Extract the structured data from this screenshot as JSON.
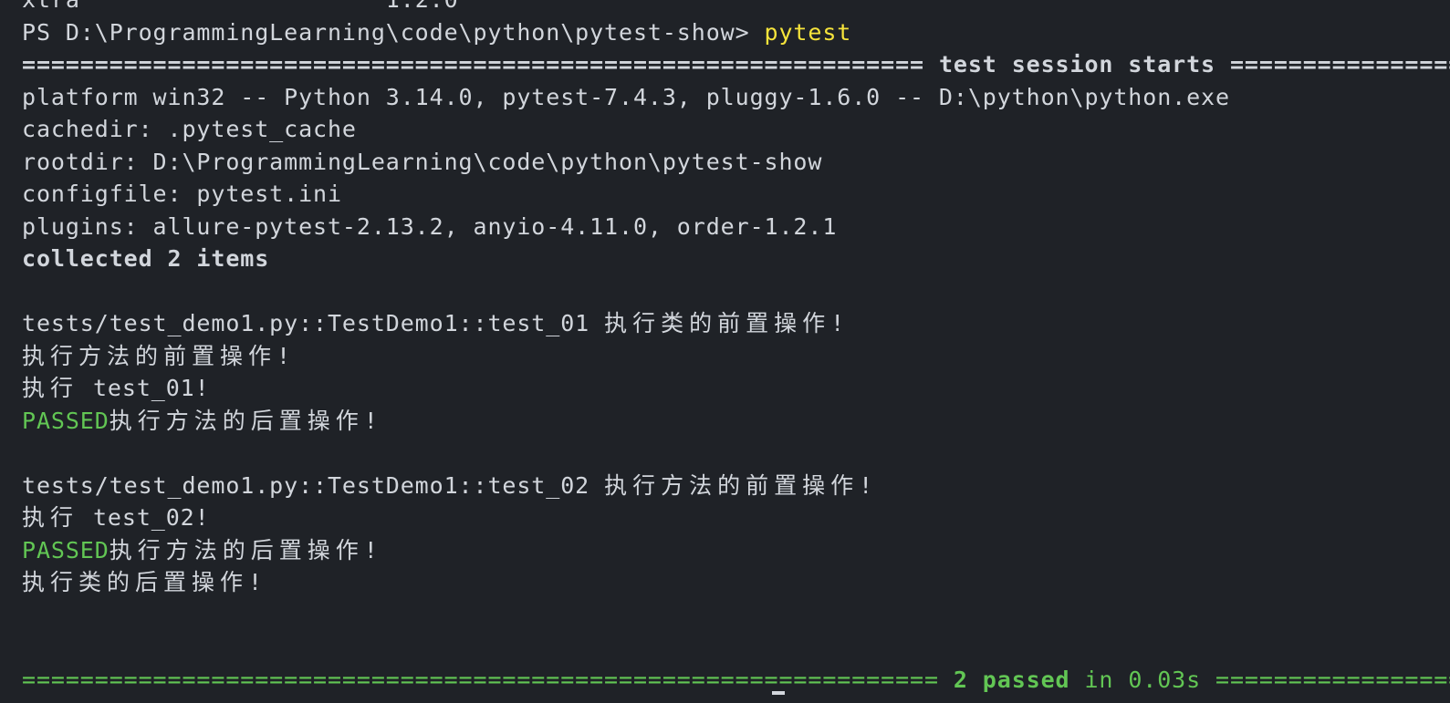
{
  "terminal": {
    "partial_top_left": "xtra",
    "partial_top_right": "1.2.0",
    "prompt": "PS D:\\ProgrammingLearning\\code\\python\\pytest-show> ",
    "command": "pytest",
    "session_sep_left": "============================================================== ",
    "session_title": "test session starts",
    "session_sep_right": " ==================================",
    "platform": "platform win32 -- Python 3.14.0, pytest-7.4.3, pluggy-1.6.0 -- D:\\python\\python.exe",
    "cachedir": "cachedir: .pytest_cache",
    "rootdir": "rootdir: D:\\ProgrammingLearning\\code\\python\\pytest-show",
    "configfile": "configfile: pytest.ini",
    "plugins": "plugins: allure-pytest-2.13.2, anyio-4.11.0, order-1.2.1",
    "collected": "collected 2 items",
    "test1": {
      "nodeid": "tests/test_demo1.py::TestDemo1::test_01 ",
      "class_setup": "执行类的前置操作!",
      "method_setup": "执行方法的前置操作!",
      "run_prefix": "执行",
      "run_name": " test_01!",
      "status": "PASSED",
      "method_teardown": "执行方法的后置操作!"
    },
    "test2": {
      "nodeid": "tests/test_demo1.py::TestDemo1::test_02 ",
      "method_setup": "执行方法的前置操作!",
      "run_prefix": "执行",
      "run_name": " test_02!",
      "status": "PASSED",
      "method_teardown": "执行方法的后置操作!",
      "class_teardown": "执行类的后置操作!"
    },
    "summary_sep_left": "=============================================================== ",
    "summary_passed": "2 passed",
    "summary_time": " in 0.03s ",
    "summary_sep_right": "===================================="
  },
  "colors": {
    "background": "#1f2227",
    "foreground": "#d2d6dc",
    "command": "#f6e43b",
    "passed": "#62c654"
  }
}
